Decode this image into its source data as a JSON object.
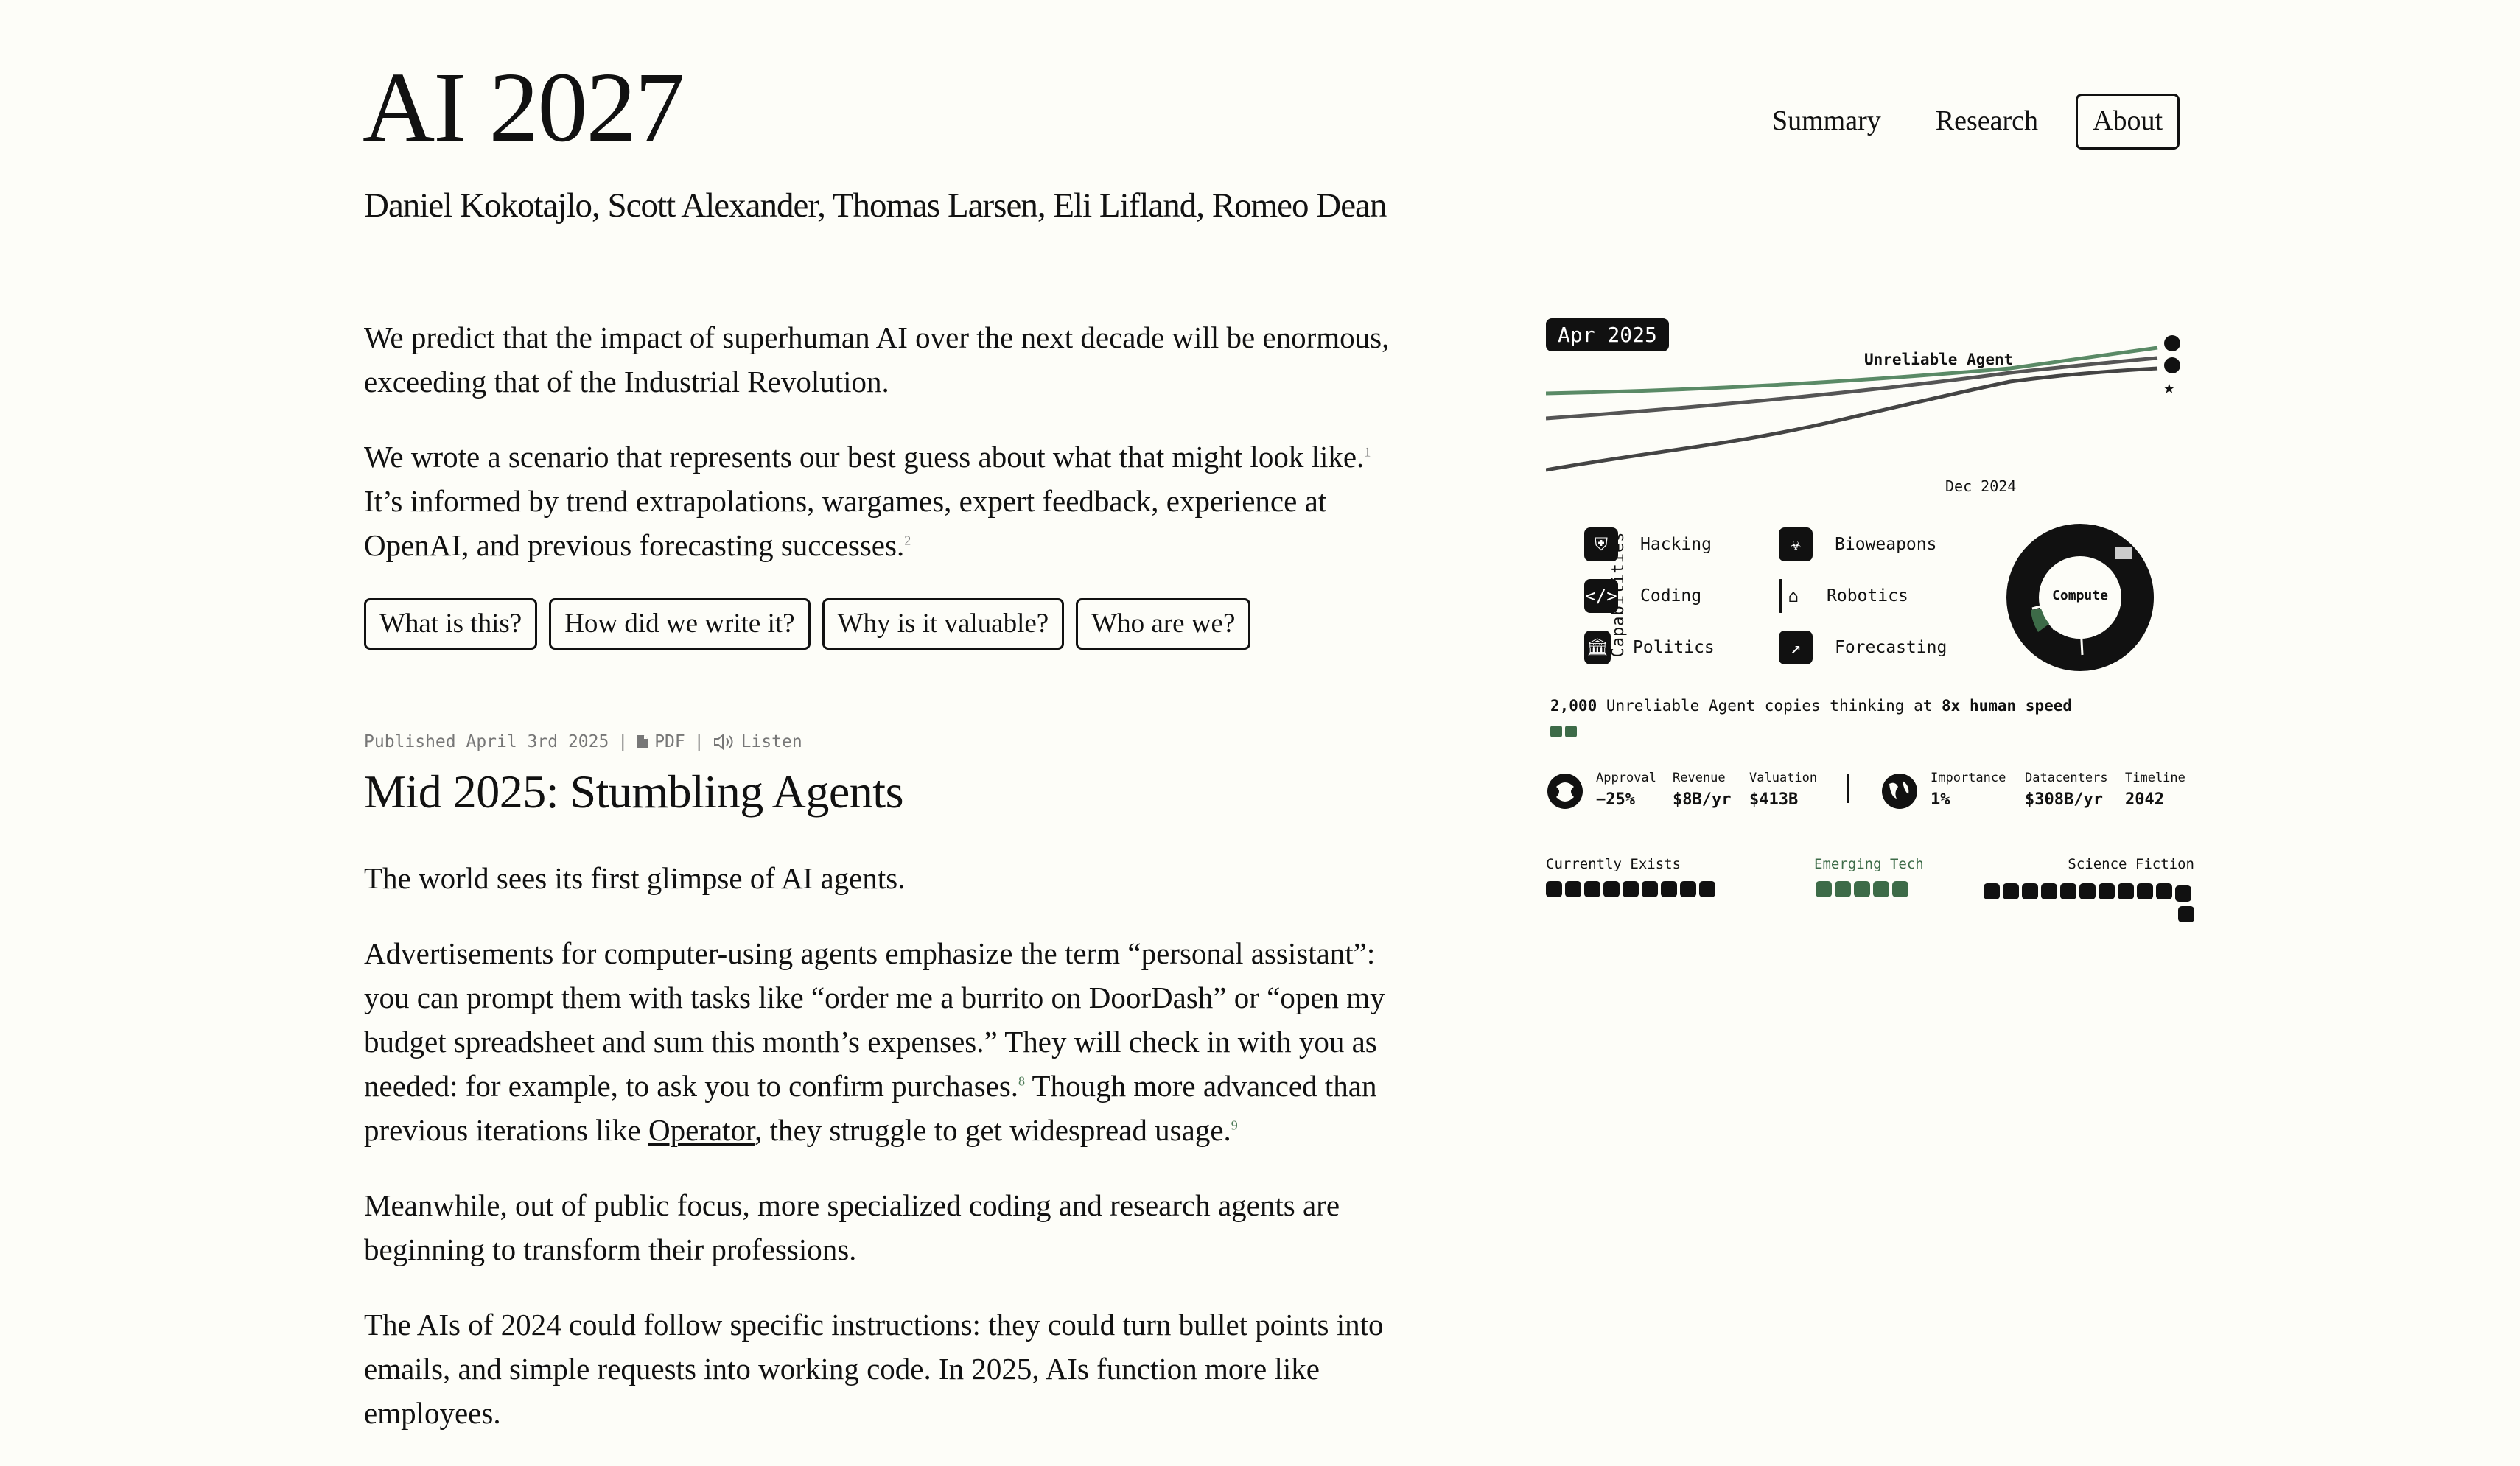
{
  "header": {
    "title": "AI 2027",
    "authors": "Daniel Kokotajlo, Scott Alexander, Thomas Larsen, Eli Lifland, Romeo Dean",
    "nav": [
      "Summary",
      "Research",
      "About"
    ]
  },
  "intro": {
    "p1": "We predict that the impact of superhuman AI over the next decade will be enormous, exceeding that of the Industrial Revolution.",
    "p2_a": "We wrote a scenario that represents our best guess about what that might look like.",
    "p2_fn1": "1",
    "p2_b": " It’s informed by trend extrapolations, wargames, expert feedback, experience at OpenAI, and previous forecasting successes.",
    "p2_fn2": "2",
    "buttons": [
      "What is this?",
      "How did we write it?",
      "Why is it valuable?",
      "Who are we?"
    ]
  },
  "section": {
    "published": "Published April 3rd 2025",
    "sep": "|",
    "pdf": "PDF",
    "listen": "Listen",
    "title": "Mid 2025: Stumbling Agents",
    "p1": "The world sees its first glimpse of AI agents.",
    "p2_a": "Advertisements for computer-using agents emphasize the term “personal assistant”: you can prompt them with tasks like “order me a burrito on DoorDash” or “open my budget spreadsheet and sum this month’s expenses.” They will check in with you as needed: for example, to ask you to confirm purchases.",
    "p2_fn8": "8",
    "p2_b": " Though more advanced than previous iterations like ",
    "p2_link": "Operator",
    "p2_c": ", they struggle to get widespread usage.",
    "p2_fn9": "9",
    "p3": "Meanwhile, out of public focus, more specialized coding and research agents are beginning to transform their professions.",
    "p4": "The AIs of 2024 could follow specific instructions: they could turn bullet points into emails, and simple requests into working code. In 2025, AIs function more like employees."
  },
  "dashboard": {
    "date": "Apr 2025",
    "trend_label": "Unreliable Agent",
    "trend_date": "Dec 2024",
    "capabilities_title": "AI Capabilities",
    "capabilities": [
      {
        "label": "Hacking",
        "icon": "shield-icon"
      },
      {
        "label": "Coding",
        "icon": "code-icon"
      },
      {
        "label": "Politics",
        "icon": "capitol-icon"
      },
      {
        "label": "Bioweapons",
        "icon": "biohazard-icon"
      },
      {
        "label": "Robotics",
        "icon": "robot-icon"
      },
      {
        "label": "Forecasting",
        "icon": "trend-icon"
      }
    ],
    "compute_label": "Compute",
    "copies_count": "2,000",
    "copies_text": " Unreliable Agent copies thinking at ",
    "copies_speed": "8x human speed",
    "stats_left": [
      {
        "label": "Approval",
        "value": "−25%"
      },
      {
        "label": "Revenue",
        "value": "$8B/yr"
      },
      {
        "label": "Valuation",
        "value": "$413B"
      }
    ],
    "stats_right": [
      {
        "label": "Importance",
        "value": "1%"
      },
      {
        "label": "Datacenters",
        "value": "$308B/yr"
      },
      {
        "label": "Timeline",
        "value": "2042"
      }
    ],
    "spectrum": {
      "exists": "Currently Exists",
      "emerging": "Emerging Tech",
      "fiction": "Science Fiction"
    },
    "colors": {
      "accent": "#3d6b48",
      "ink": "#111111",
      "trend_green": "#5a8a66"
    }
  }
}
